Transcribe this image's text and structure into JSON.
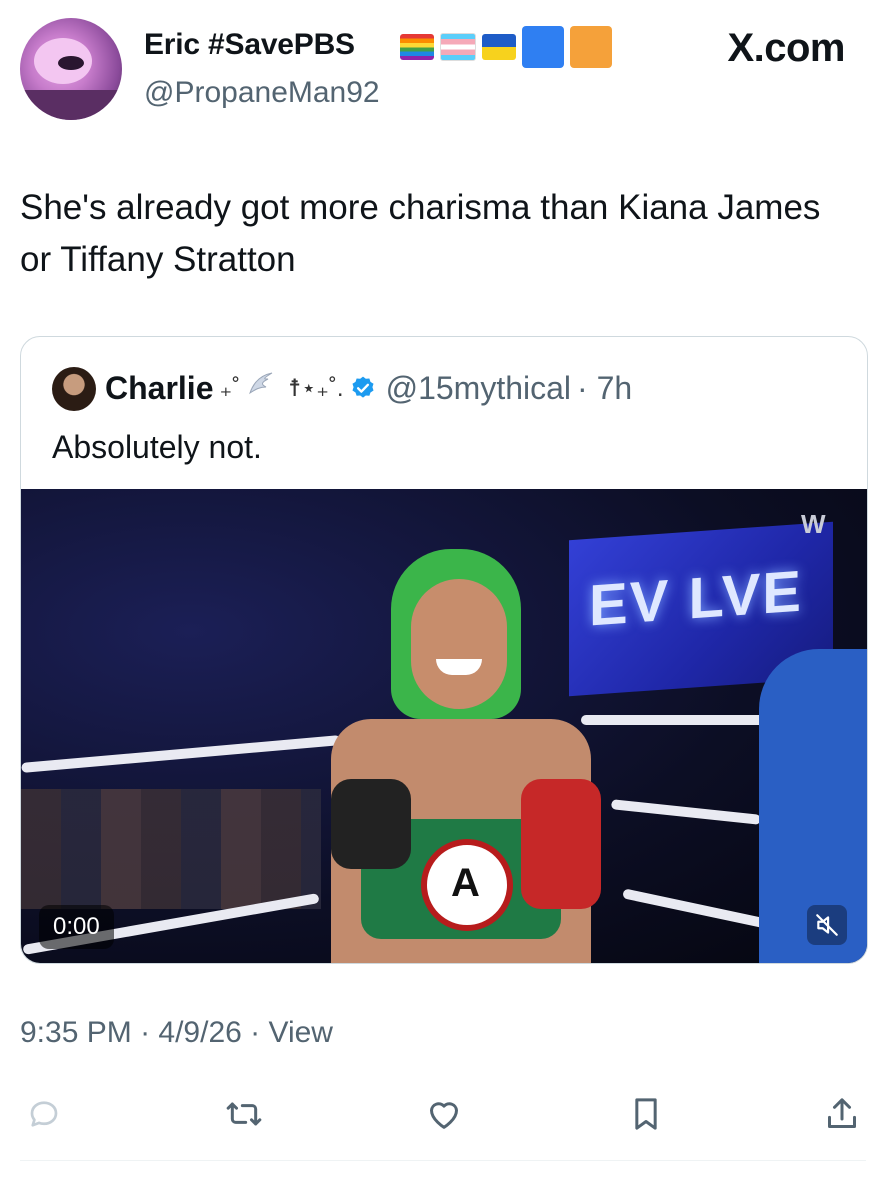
{
  "author": {
    "display_name": "Eric #SavePBS",
    "handle": "@PropaneMan92",
    "flags": [
      "rainbow-flag",
      "trans-flag",
      "ukraine-flag",
      "blue-square",
      "orange-square"
    ]
  },
  "site": {
    "label": "X.com"
  },
  "tweet": {
    "text": "She's already got more charisma than Kiana James or Tiffany Stratton"
  },
  "quote": {
    "name": "Charlie",
    "decoration_1": "₊˚",
    "decoration_2": "☨⋆₊˚.",
    "handle": "@15mythical",
    "age": "· 7h",
    "text": "Absolutely not.",
    "media": {
      "screen_text": "EV LVE",
      "brand_mark": "W",
      "time": "0:00",
      "muted": true
    }
  },
  "meta": {
    "time": "9:35 PM",
    "date": "· 4/9/26",
    "view": "· View"
  },
  "actions": [
    "reply-icon",
    "retweet-icon",
    "like-icon",
    "bookmark-icon",
    "share-icon"
  ],
  "colors": {
    "verified": "#1d9bf0",
    "muted_text": "#536471",
    "border": "#cfd9de"
  }
}
